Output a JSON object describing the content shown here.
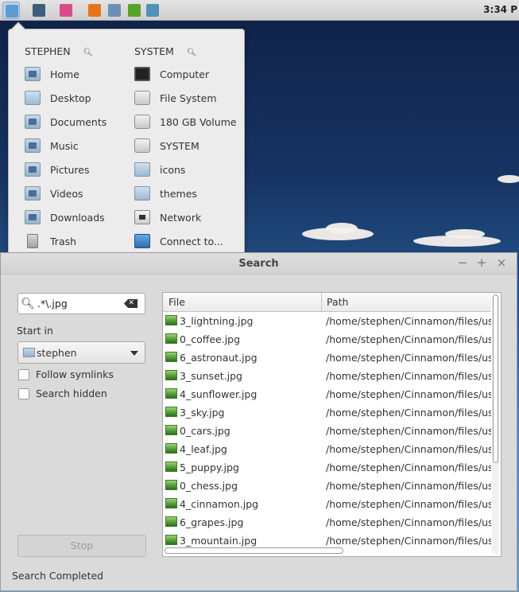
{
  "panel": {
    "launchers": [
      {
        "name": "files-launcher-icon",
        "color": "#5f9bd3",
        "active": true
      },
      {
        "name": "system-monitor-launcher-icon",
        "color": "#3d5f7d",
        "active": false
      },
      {
        "name": "color-picker-launcher-icon",
        "color": "#d94c8a",
        "active": false
      },
      {
        "name": "firefox-launcher-icon",
        "color": "#e5741c",
        "active": false
      },
      {
        "name": "scanner-launcher-icon",
        "color": "#6b8fb5",
        "active": false
      },
      {
        "name": "spotify-launcher-icon",
        "color": "#5aa127",
        "active": false
      },
      {
        "name": "remote-desktop-launcher-icon",
        "color": "#4f91b7",
        "active": false
      }
    ],
    "clock": "3:34 P"
  },
  "places_menu": {
    "user_heading": "STEPHEN",
    "system_heading": "SYSTEM",
    "user_items": [
      {
        "label": "Home",
        "icon": "home-folder-icon",
        "kind": "folder"
      },
      {
        "label": "Desktop",
        "icon": "desktop-folder-icon",
        "kind": "plain"
      },
      {
        "label": "Documents",
        "icon": "documents-folder-icon",
        "kind": "folder"
      },
      {
        "label": "Music",
        "icon": "music-folder-icon",
        "kind": "folder"
      },
      {
        "label": "Pictures",
        "icon": "pictures-folder-icon",
        "kind": "folder"
      },
      {
        "label": "Videos",
        "icon": "videos-folder-icon",
        "kind": "folder"
      },
      {
        "label": "Downloads",
        "icon": "downloads-folder-icon",
        "kind": "folder"
      },
      {
        "label": "Trash",
        "icon": "trash-icon",
        "kind": "trash"
      }
    ],
    "system_items": [
      {
        "label": "Computer",
        "icon": "computer-icon",
        "kind": "monitor"
      },
      {
        "label": "File System",
        "icon": "drive-icon",
        "kind": "disk"
      },
      {
        "label": "180 GB Volume",
        "icon": "drive-icon",
        "kind": "disk"
      },
      {
        "label": "SYSTEM",
        "icon": "drive-icon",
        "kind": "disk"
      },
      {
        "label": "icons",
        "icon": "folder-icon",
        "kind": "plain"
      },
      {
        "label": "themes",
        "icon": "folder-icon",
        "kind": "plain"
      },
      {
        "label": "Network",
        "icon": "network-icon",
        "kind": "net"
      },
      {
        "label": "Connect to...",
        "icon": "connect-icon",
        "kind": "connect"
      }
    ]
  },
  "search_window": {
    "title": "Search",
    "controls": {
      "minimize": "−",
      "maximize": "+",
      "close": "×"
    },
    "query": ".*\\.jpg",
    "start_in_label": "Start in",
    "start_in_value": "stephen",
    "follow_symlinks_label": "Follow symlinks",
    "search_hidden_label": "Search hidden",
    "stop_label": "Stop",
    "status": "Search Completed",
    "columns": {
      "file": "File",
      "path": "Path"
    },
    "results": [
      {
        "file": "3_lightning.jpg",
        "path": "/home/stephen/Cinnamon/files/usr/sh"
      },
      {
        "file": "0_coffee.jpg",
        "path": "/home/stephen/Cinnamon/files/usr/sh"
      },
      {
        "file": "6_astronaut.jpg",
        "path": "/home/stephen/Cinnamon/files/usr/sh"
      },
      {
        "file": "3_sunset.jpg",
        "path": "/home/stephen/Cinnamon/files/usr/sh"
      },
      {
        "file": "4_sunflower.jpg",
        "path": "/home/stephen/Cinnamon/files/usr/sh"
      },
      {
        "file": "3_sky.jpg",
        "path": "/home/stephen/Cinnamon/files/usr/sh"
      },
      {
        "file": "0_cars.jpg",
        "path": "/home/stephen/Cinnamon/files/usr/sh"
      },
      {
        "file": "4_leaf.jpg",
        "path": "/home/stephen/Cinnamon/files/usr/sh"
      },
      {
        "file": "5_puppy.jpg",
        "path": "/home/stephen/Cinnamon/files/usr/sh"
      },
      {
        "file": "0_chess.jpg",
        "path": "/home/stephen/Cinnamon/files/usr/sh"
      },
      {
        "file": "4_cinnamon.jpg",
        "path": "/home/stephen/Cinnamon/files/usr/sh"
      },
      {
        "file": "6_grapes.jpg",
        "path": "/home/stephen/Cinnamon/files/usr/sh"
      },
      {
        "file": "3_mountain.jpg",
        "path": "/home/stephen/Cinnamon/files/usr/sh"
      }
    ]
  }
}
